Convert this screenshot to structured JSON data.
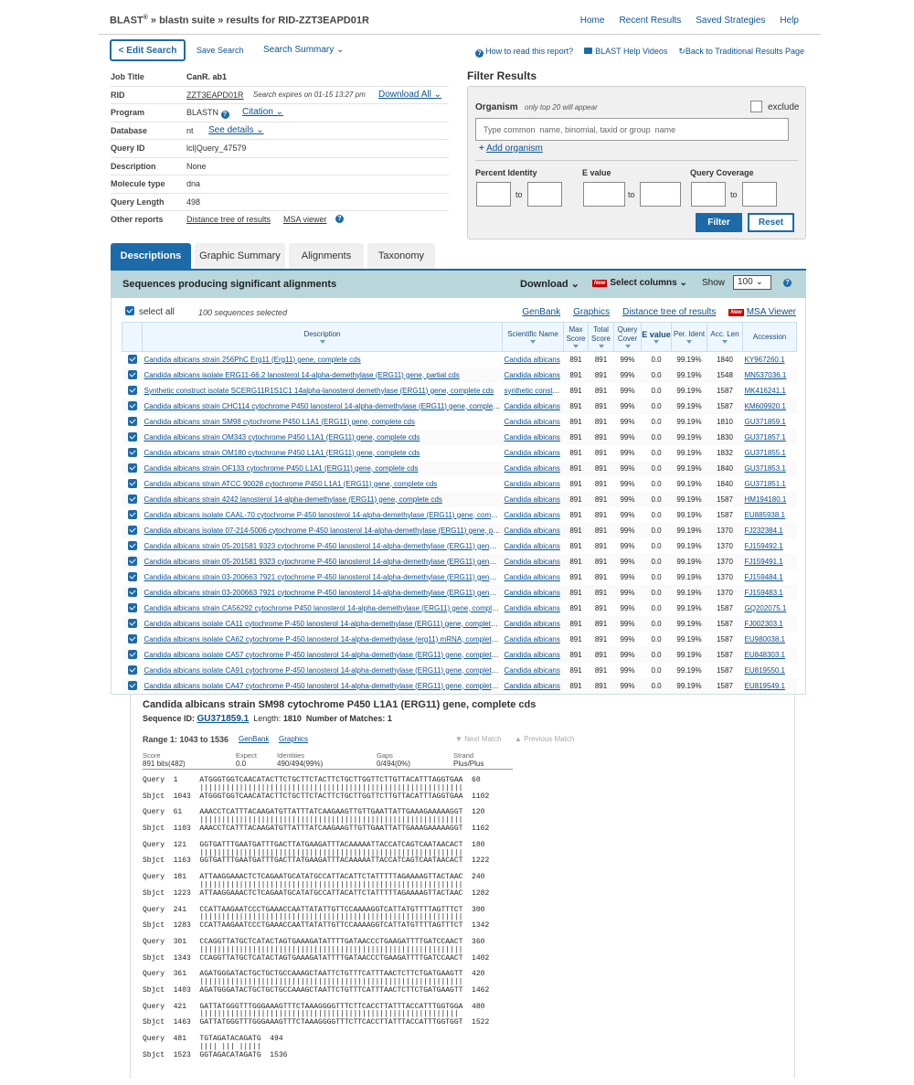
{
  "header": {
    "brand": "BLAST",
    "brand_sup": "®",
    "crumb": " » blastn suite » results for RID-ZZT3EAPD01R",
    "nav": [
      "Home",
      "Recent Results",
      "Saved Strategies",
      "Help"
    ]
  },
  "toolbar": {
    "edit_search": "< Edit Search",
    "save_search": "Save Search",
    "search_summary": "Search Summary ⌄",
    "how_to_read": "How to read this report?",
    "help_videos": "BLAST Help Videos",
    "back_traditional": "Back to Traditional Results Page"
  },
  "job": {
    "rows": [
      {
        "label": "Job Title",
        "value": "CanR. ab1"
      },
      {
        "label": "RID",
        "value": "ZZT3EAPD01R",
        "note": "Search expires on 01-15 13:27 pm",
        "link": "Download All ⌄"
      },
      {
        "label": "Program",
        "value": "BLASTN",
        "link": "Citation ⌄"
      },
      {
        "label": "Database",
        "value": "nt",
        "link": "See details ⌄"
      },
      {
        "label": "Query ID",
        "value": "lcl|Query_47579"
      },
      {
        "label": "Description",
        "value": "None"
      },
      {
        "label": "Molecule type",
        "value": "dna"
      },
      {
        "label": "Query Length",
        "value": "498"
      },
      {
        "label": "Other reports",
        "value": "Distance tree of results",
        "link": "MSA viewer"
      }
    ]
  },
  "filter": {
    "title": "Filter Results",
    "organism_label": "Organism",
    "organism_note": "only top 20 will appear",
    "exclude_label": "exclude",
    "organism_placeholder": "Type common  name, binomial, taxid or group  name",
    "add_organism": "Add organism",
    "percent_identity": "Percent Identity",
    "e_value": "E value",
    "query_coverage": "Query Coverage",
    "to": "to",
    "filter_btn": "Filter",
    "reset_btn": "Reset"
  },
  "tabs": [
    "Descriptions",
    "Graphic Summary",
    "Alignments",
    "Taxonomy"
  ],
  "seq_header": {
    "title": "Sequences producing significant alignments",
    "download": "Download  ⌄",
    "new_badge": "New",
    "select_columns": "Select columns  ⌄",
    "show_label": "Show",
    "show_value": "100 ⌄"
  },
  "desc": {
    "select_all": "select all",
    "selected_count": "100 sequences selected",
    "links": [
      "GenBank",
      "Graphics",
      "Distance tree of results",
      "MSA Viewer"
    ],
    "columns": [
      "Description",
      "Scientific Name",
      "Max Score",
      "Total Score",
      "Query Cover",
      "E value",
      "Per. Ident",
      "Acc. Len",
      "Accession"
    ],
    "rows": [
      [
        "Candida albicans strain 256PhC Erg11 (Erg11) gene, complete cds",
        "Candida albicans",
        "891",
        "891",
        "99%",
        "0.0",
        "99.19%",
        "1840",
        "KY967260.1"
      ],
      [
        "Candida albicans isolate ERG11-66.2 lanosterol 14-alpha-demethylase (ERG11) gene, partial cds",
        "Candida albicans",
        "891",
        "891",
        "99%",
        "0.0",
        "99.19%",
        "1548",
        "MN537036.1"
      ],
      [
        "Synthetic construct isolate SCERG11R1S1C1 14alpha-lanosterol demethylase (ERG11) gene, complete cds",
        "synthetic construct",
        "891",
        "891",
        "99%",
        "0.0",
        "99.19%",
        "1587",
        "MK416241.1"
      ],
      [
        "Candida albicans strain CHC114 cytochrome P450 lanosterol 14-alpha-demethylase (ERG11) gene, complete cds",
        "Candida albicans",
        "891",
        "891",
        "99%",
        "0.0",
        "99.19%",
        "1587",
        "KM609920.1"
      ],
      [
        "Candida albicans strain SM98 cytochrome P450 L1A1 (ERG11) gene, complete cds",
        "Candida albicans",
        "891",
        "891",
        "99%",
        "0.0",
        "99.19%",
        "1810",
        "GU371859.1"
      ],
      [
        "Candida albicans strain OM343 cytochrome P450 L1A1 (ERG11) gene, complete cds",
        "Candida albicans",
        "891",
        "891",
        "99%",
        "0.0",
        "99.19%",
        "1830",
        "GU371857.1"
      ],
      [
        "Candida albicans strain OM180 cytochrome P450 L1A1 (ERG11) gene, complete cds",
        "Candida albicans",
        "891",
        "891",
        "99%",
        "0.0",
        "99.19%",
        "1832",
        "GU371855.1"
      ],
      [
        "Candida albicans strain OF133 cytochrome P450 L1A1 (ERG11) gene, complete cds",
        "Candida albicans",
        "891",
        "891",
        "99%",
        "0.0",
        "99.19%",
        "1840",
        "GU371853.1"
      ],
      [
        "Candida albicans strain ATCC 90028 cytochrome P450 L1A1 (ERG11) gene, complete cds",
        "Candida albicans",
        "891",
        "891",
        "99%",
        "0.0",
        "99.19%",
        "1840",
        "GU371851.1"
      ],
      [
        "Candida albicans strain 4242 lanosterol 14-alpha-demethylase (ERG11) gene, complete cds",
        "Candida albicans",
        "891",
        "891",
        "99%",
        "0.0",
        "99.19%",
        "1587",
        "HM194180.1"
      ],
      [
        "Candida albicans isolate CAAL-70 cytochrome P-450 lanosterol 14-alpha-demethylase (ERG11) gene, complete cds",
        "Candida albicans",
        "891",
        "891",
        "99%",
        "0.0",
        "99.19%",
        "1587",
        "EU885938.1"
      ],
      [
        "Candida albicans isolate 07-214-5006 cytochrome P-450 lanosterol 14-alpha-demethylase (ERG11) gene, partial cds",
        "Candida albicans",
        "891",
        "891",
        "99%",
        "0.0",
        "99.19%",
        "1370",
        "FJ232384.1"
      ],
      [
        "Candida albicans strain 05-201581 9323 cytochrome P-450 lanosterol 14-alpha-demethylase (ERG11) gene, partial cds",
        "Candida albicans",
        "891",
        "891",
        "99%",
        "0.0",
        "99.19%",
        "1370",
        "FJ159492.1"
      ],
      [
        "Candida albicans strain 05-201581 9323 cytochrome P-450 lanosterol 14-alpha-demethylase (ERG11) gene, partial cds",
        "Candida albicans",
        "891",
        "891",
        "99%",
        "0.0",
        "99.19%",
        "1370",
        "FJ159491.1"
      ],
      [
        "Candida albicans strain 03-200663 7921 cytochrome P-450 lanosterol 14-alpha-demethylase (ERG11) gene, partial cds",
        "Candida albicans",
        "891",
        "891",
        "99%",
        "0.0",
        "99.19%",
        "1370",
        "FJ159484.1"
      ],
      [
        "Candida albicans strain 03-200663 7921 cytochrome P-450 lanosterol 14-alpha-demethylase (ERG11) gene, partial cds",
        "Candida albicans",
        "891",
        "891",
        "99%",
        "0.0",
        "99.19%",
        "1370",
        "FJ159483.1"
      ],
      [
        "Candida albicans strain CA56292 cytochrome P450 lanosterol 14-alpha-demethylase (ERG11) gene, complete cds",
        "Candida albicans",
        "891",
        "891",
        "99%",
        "0.0",
        "99.19%",
        "1587",
        "GQ202075.1"
      ],
      [
        "Candida albicans isolate CA11 cytochrome P-450 lanosterol 14-alpha-demethylase (ERG11) gene, complete cds",
        "Candida albicans",
        "891",
        "891",
        "99%",
        "0.0",
        "99.19%",
        "1587",
        "FJ002303.1"
      ],
      [
        "Candida albicans isolate CA62 cytochrome P-450 lanosterol 14-alpha-demethylase (erg11) mRNA, complete cds",
        "Candida albicans",
        "891",
        "891",
        "99%",
        "0.0",
        "99.19%",
        "1587",
        "EU980038.1"
      ],
      [
        "Candida albicans isolate CA57 cytochrome P-450 lanosterol 14-alpha-demethylase (ERG11) gene, complete cds",
        "Candida albicans",
        "891",
        "891",
        "99%",
        "0.0",
        "99.19%",
        "1587",
        "EU848303.1"
      ],
      [
        "Candida albicans isolate CA91 cytochrome P-450 lanosterol 14-alpha-demethylase (ERG11) gene, complete cds",
        "Candida albicans",
        "891",
        "891",
        "99%",
        "0.0",
        "99.19%",
        "1587",
        "EU819550.1"
      ],
      [
        "Candida albicans isolate CA47 cytochrome P-450 lanosterol 14-alpha-demethylase (ERG11) gene, complete cds",
        "Candida albicans",
        "891",
        "891",
        "99%",
        "0.0",
        "99.19%",
        "1587",
        "EU819549.1"
      ]
    ]
  },
  "alignment": {
    "title": "Candida albicans strain SM98 cytochrome P450 L1A1 (ERG11) gene, complete cds",
    "seq_id_label": "Sequence ID:",
    "seq_id": "GU371859.1",
    "length_label": "Length:",
    "length": "1810",
    "matches_label": "Number of Matches:",
    "matches": "1",
    "range": "Range 1: 1043 to 1536",
    "genbank": "GenBank",
    "graphics": "Graphics",
    "next_match": "▼ Next Match",
    "prev_match": "▲ Previous Match",
    "stats": [
      {
        "head": "Score",
        "val": "891 bits(482)"
      },
      {
        "head": "Expect",
        "val": "0.0"
      },
      {
        "head": "Identities",
        "val": "490/494(99%)"
      },
      {
        "head": "Gaps",
        "val": "0/494(0%)"
      },
      {
        "head": "Strand",
        "val": "Plus/Plus"
      }
    ],
    "text": "Query  1     ATGGGTGGTCAACATACTTCTGCTTCTACTTCTGCTTGGTTCTTGTTACATTTAGGTGAA  60\n             ||||||||||||||||||||||||||||||||||||||||||||||||||||||||||||\nSbjct  1043  ATGGGTGGTCAACATACTTCTGCTTCTACTTCTGCTTGGTTCTTGTTACATTTAGGTGAA  1102\n\nQuery  61    AAACCTCATTTACAAGATGTTATTTATCAAGAAGTTGTTGAATTATTGAAAGAAAAAGGT  120\n             ||||||||||||||||||||||||||||||||||||||||||||||||||||||||||||\nSbjct  1103  AAACCTCATTTACAAGATGTTATTTATCAAGAAGTTGTTGAATTATTGAAAGAAAAAGGT  1162\n\nQuery  121   GGTGATTTGAATGATTTGACTTATGAAGATTTACAAAAATTACCATCAGTCAATAACACT  180\n             ||||||||||||||||||||||||||||||||||||||||||||||||||||||||||||\nSbjct  1163  GGTGATTTGAATGATTTGACTTATGAAGATTTACAAAAATTACCATCAGTCAATAACACT  1222\n\nQuery  181   ATTAAGGAAACTCTCAGAATGCATATGCCATTACATTCTATTTTTAGAAAAGTTACTAAC  240\n             ||||||||||||||||||||||||||||||||||||||||||||||||||||||||||||\nSbjct  1223  ATTAAGGAAACTCTCAGAATGCATATGCCATTACATTCTATTTTTAGAAAAGTTACTAAC  1282\n\nQuery  241   CCATTAAGAATCCCTGAAACCAATTATATTGTTCCAAAAGGTCATTATGTTTTAGTTTCT  300\n             ||||||||||||||||||||||||||||||||||||||||||||||||||||||||||||\nSbjct  1283  CCATTAAGAATCCCTGAAACCAATTATATTGTTCCAAAAGGTCATTATGTTTTAGTTTCT  1342\n\nQuery  301   CCAGGTTATGCTCATACTAGTGAAAGATATTTTGATAACCCTGAAGATTTTGATCCAACT  360\n             ||||||||||||||||||||||||||||||||||||||||||||||||||||||||||||\nSbjct  1343  CCAGGTTATGCTCATACTAGTGAAAGATATTTTGATAACCCTGAAGATTTTGATCCAACT  1402\n\nQuery  361   AGATGGGATACTGCTGCTGCCAAAGCTAATTCTGTTTCATTTAACTCTTCTGATGAAGTT  420\n             ||||||||||||||||||||||||||||||||||||||||||||||||||||||||||||\nSbjct  1403  AGATGGGATACTGCTGCTGCCAAAGCTAATTCTGTTTCATTTAACTCTTCTGATGAAGTT  1462\n\nQuery  421   GATTATGGGTTTGGGAAAGTTTCTAAAGGGGTTTCTTCACCTTATTTACCATTTGGTGGA  480\n             ||||||||||||||||||||||||||||||||||||||||||||||||||||||||||| \nSbjct  1463  GATTATGGGTTTGGGAAAGTTTCTAAAGGGGTTTCTTCACCTTATTTACCATTTGGTGGT  1522\n\nQuery  481   TGTAGATACAGATG  494\n             |||| ||| |||||\nSbjct  1523  GGTAGACATAGATG  1536"
  }
}
